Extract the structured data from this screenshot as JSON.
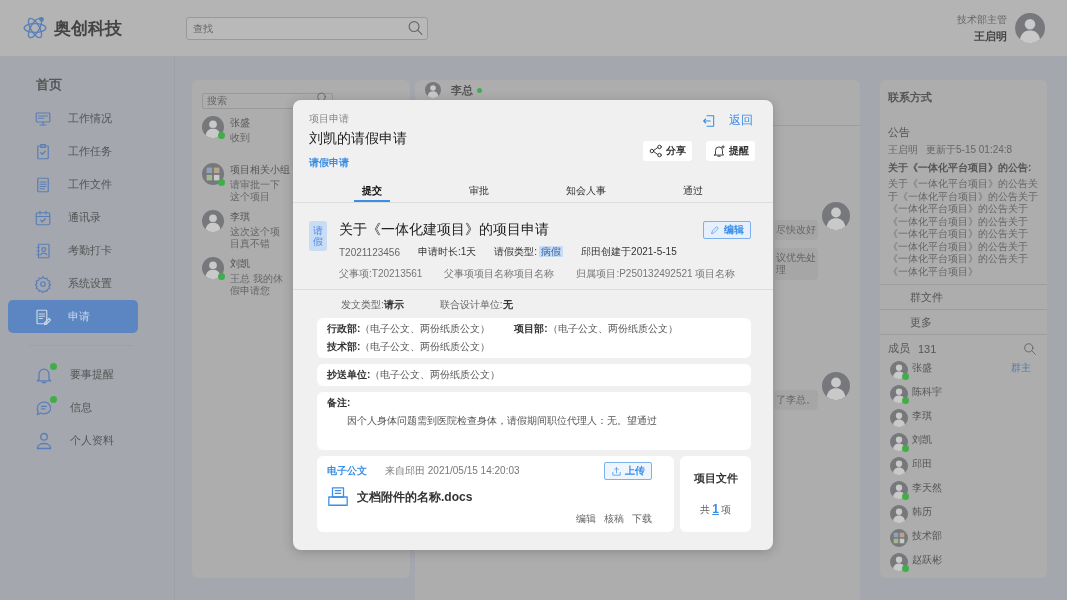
{
  "header": {
    "brand": "奥创科技",
    "search": {
      "placeholder": "查找"
    },
    "user": {
      "role": "技术部主管",
      "name": "王启明"
    }
  },
  "sidebar": {
    "heading": "首页",
    "items": [
      {
        "label": "工作情况",
        "selected": false
      },
      {
        "label": "工作任务",
        "selected": false
      },
      {
        "label": "工作文件",
        "selected": false
      },
      {
        "label": "通讯录",
        "selected": false
      },
      {
        "label": "考勤打卡",
        "selected": false
      },
      {
        "label": "系统设置",
        "selected": false
      },
      {
        "label": "申请",
        "selected": true
      }
    ],
    "secondary_items": [
      {
        "label": "要事提醒",
        "selected": false,
        "badge": true
      },
      {
        "label": "信息",
        "selected": false,
        "badge": true
      },
      {
        "label": "个人资料",
        "selected": false,
        "badge": false
      }
    ]
  },
  "chat_list": {
    "search": {
      "placeholder": "搜索"
    },
    "items": [
      {
        "name": "张盛",
        "preview": "收到",
        "online": true,
        "kind": "person"
      },
      {
        "name": "项目相关小组",
        "preview": "请审批一下这个项目",
        "online": true,
        "kind": "group"
      },
      {
        "name": "李琪",
        "preview": "这次这个项目真不错",
        "online": false,
        "kind": "person"
      },
      {
        "name": "刘凯",
        "preview": "王总 我的休假申请您",
        "online": true,
        "kind": "person"
      }
    ]
  },
  "chat": {
    "contact": {
      "name": "李总",
      "online": true
    },
    "message_groups": [
      {
        "messages": [
          "尽快改好",
          "议优先处理"
        ]
      },
      {
        "messages": [
          "了李总。"
        ]
      }
    ]
  },
  "right_panel": {
    "title": "联系方式",
    "notice": {
      "heading": "公告",
      "author": "王启明",
      "updated": "更新于5-15  01:24:8",
      "title": "关于《一体化平台项目》的公告:",
      "body": "关于《一体化平台项目》的公告关于《一体化平台项目》的公告关于《一体化平台项目》的公告关于《一体化平台项目》的公告关于《一体化平台项目》的公告关于《一体化平台项目》的公告关于《一体化平台项目》的公告关于《一体化平台项目》"
    },
    "links": [
      "群文件",
      "更多"
    ],
    "members": {
      "label": "成员",
      "count": "131",
      "items": [
        {
          "name": "张盛",
          "online": true,
          "kind": "person",
          "role": "群主"
        },
        {
          "name": "陈科宇",
          "online": true,
          "kind": "person"
        },
        {
          "name": "李琪",
          "online": false,
          "kind": "person"
        },
        {
          "name": "刘凯",
          "online": true,
          "kind": "person"
        },
        {
          "name": "邱田",
          "online": false,
          "kind": "person"
        },
        {
          "name": "李天然",
          "online": true,
          "kind": "person"
        },
        {
          "name": "韩历",
          "online": false,
          "kind": "person"
        },
        {
          "name": "技术部",
          "online": false,
          "kind": "group"
        },
        {
          "name": "赵跃彬",
          "online": true,
          "kind": "person"
        }
      ]
    }
  },
  "modal": {
    "breadcrumb": "项目申请",
    "title": "刘凯的请假申请",
    "subtitle": "请假申请",
    "back": "返回",
    "actions": [
      "分享",
      "提醒"
    ],
    "steps": [
      {
        "label": "提交",
        "selected": true
      },
      {
        "label": "审批",
        "selected": false
      },
      {
        "label": "知会人事",
        "selected": false
      },
      {
        "label": "通过",
        "selected": false
      }
    ],
    "document": {
      "badge": "请假",
      "title": "关于《一体化建项目》的项目申请",
      "edit": "编辑",
      "code": "T2021123456",
      "duration": "申请时长:1天",
      "leave_type_label": "请假类型:",
      "leave_type": "病假",
      "created": "邱田创建于2021-5-15",
      "parent": "父事项:T20213561",
      "parent_name": "父事项项目名称项目名称",
      "project": "归属项目:P250132492521 项目名称",
      "doc_type": "发文类型:**请示**",
      "joint_unit": "联合设计单位:**无**",
      "departments": [
        "**行政部:**（电子公文、两份纸质公文）",
        "**项目部:**（电子公文、两份纸质公文）",
        "**技术部:**（电子公文、两份纸质公文）"
      ],
      "cc": "**抄送单位:**（电子公文、两份纸质公文）",
      "remark_label": "备注:",
      "remark": "因个人身体问题需到医院检查身体，请假期间职位代理人：无。望通过"
    },
    "attachment": {
      "tag": "电子公文",
      "source": "来自邱田 2021/05/15 14:20:03",
      "upload": "上传",
      "file_name": "文档附件的名称.docs",
      "actions": [
        "编辑",
        "核稿",
        "下载"
      ]
    },
    "project_files": {
      "title": "项目文件",
      "count": "共**1**项"
    }
  }
}
